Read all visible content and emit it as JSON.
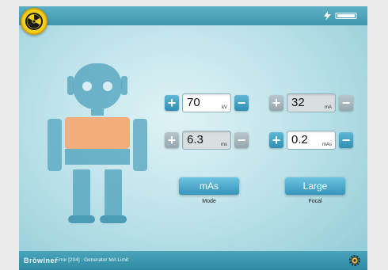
{
  "header": {
    "status_icons": [
      "bolt-icon",
      "battery-icon"
    ]
  },
  "controls": {
    "kv": {
      "value": "70",
      "unit": "kV"
    },
    "ma": {
      "value": "32",
      "unit": "mA"
    },
    "ms": {
      "value": "6.3",
      "unit": "ms"
    },
    "mas": {
      "value": "0.2",
      "unit": "mAs"
    }
  },
  "mode": {
    "button_label": "mAs",
    "caption": "Mode"
  },
  "focal": {
    "button_label": "Large",
    "caption": "Focal"
  },
  "footer": {
    "brand": "Brōwiner",
    "error": "Error [204] : Generator MA Limit"
  },
  "colors": {
    "accent": "#3595bc",
    "robot": "#5aa8c2",
    "robot_chest": "#f1ad7c",
    "radiation": "#f3cf1e"
  }
}
